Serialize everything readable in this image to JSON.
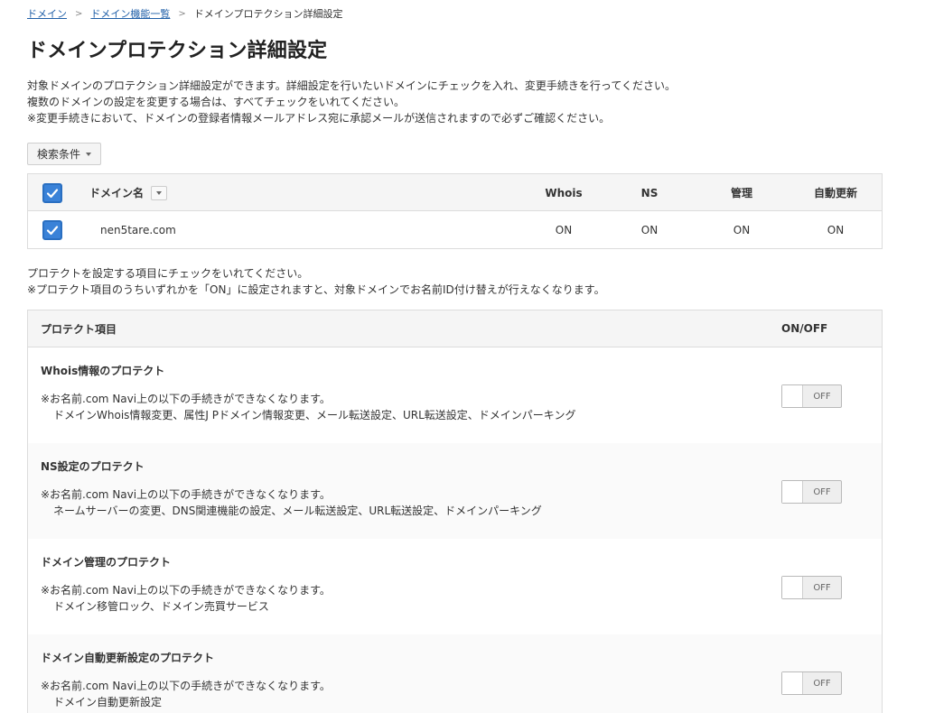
{
  "breadcrumb": {
    "items": [
      "ドメイン",
      "ドメイン機能一覧"
    ],
    "current": "ドメインプロテクション詳細設定"
  },
  "page_title": "ドメインプロテクション詳細設定",
  "intro": [
    "対象ドメインのプロテクション詳細設定ができます。詳細設定を行いたいドメインにチェックを入れ、変更手続きを行ってください。",
    "複数のドメインの設定を変更する場合は、すべてチェックをいれてください。",
    "※変更手続きにおいて、ドメインの登録者情報メールアドレス宛に承認メールが送信されますので必ずご確認ください。"
  ],
  "search_button": "検索条件",
  "domain_table": {
    "headers": {
      "name": "ドメイン名",
      "whois": "Whois",
      "ns": "NS",
      "admin": "管理",
      "auto": "自動更新"
    },
    "select_all_checked": true,
    "rows": [
      {
        "name": "nen5tare.com",
        "whois": "ON",
        "ns": "ON",
        "admin": "ON",
        "auto": "ON",
        "checked": true
      }
    ]
  },
  "protect_note": [
    "プロテクトを設定する項目にチェックをいれてください。",
    "※プロテクト項目のうちいずれかを「ON」に設定されますと、対象ドメインでお名前ID付け替えが行えなくなります。"
  ],
  "protect_table": {
    "header_item": "プロテクト項目",
    "header_onoff": "ON/OFF",
    "rows": [
      {
        "title": "Whois情報のプロテクト",
        "note": "※お名前.com Navi上の以下の手続きができなくなります。",
        "detail": "ドメインWhois情報変更、属性J Pドメイン情報変更、メール転送設定、URL転送設定、ドメインパーキング",
        "state": "OFF"
      },
      {
        "title": "NS設定のプロテクト",
        "note": "※お名前.com Navi上の以下の手続きができなくなります。",
        "detail": "ネームサーバーの変更、DNS関連機能の設定、メール転送設定、URL転送設定、ドメインパーキング",
        "state": "OFF"
      },
      {
        "title": "ドメイン管理のプロテクト",
        "note": "※お名前.com Navi上の以下の手続きができなくなります。",
        "detail": "ドメイン移管ロック、ドメイン売買サービス",
        "state": "OFF"
      },
      {
        "title": "ドメイン自動更新設定のプロテクト",
        "note": "※お名前.com Navi上の以下の手続きができなくなります。",
        "detail": "ドメイン自動更新設定",
        "state": "OFF"
      }
    ]
  },
  "colors": {
    "link": "#1f5fa8",
    "checkbox": "#3a82d8",
    "border": "#dcdcdc",
    "header_bg": "#f5f5f5"
  }
}
